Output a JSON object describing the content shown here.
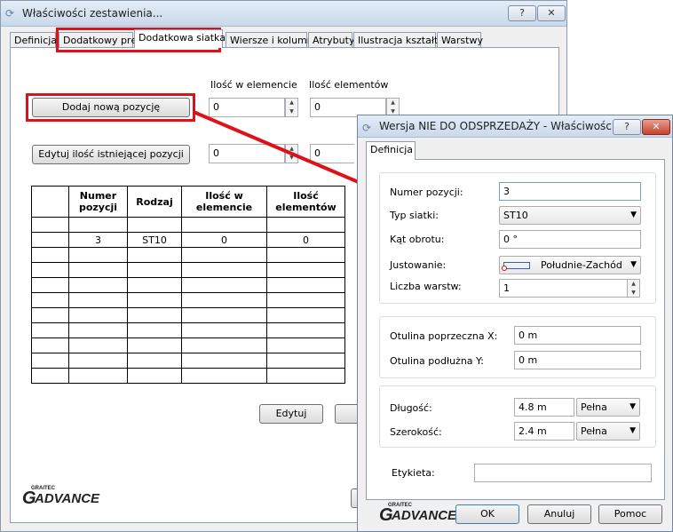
{
  "main_window": {
    "title": "Właściwości zestawienia...",
    "help_btn": "?",
    "close_btn": "✕",
    "tabs": [
      "Definicja",
      "Dodatkowy pręt",
      "Dodatkowa siatka",
      "Wiersze i kolumny",
      "Atrybuty",
      "Ilustracja kształtu",
      "Warstwy"
    ],
    "active_tab": "Dodatkowa siatka",
    "label_qty_element": "Ilość w elemencie",
    "label_qty_elements": "Ilość elementów",
    "add_btn": "Dodaj nową pozycję",
    "edit_qty_btn": "Edytuj ilość istniejącej pozycji",
    "field1": "0",
    "field2": "0",
    "field3": "0",
    "field4": "0",
    "table": {
      "headers": [
        "Numer pozycji",
        "Rodzaj",
        "Ilość w elemencie",
        "Ilość elementów"
      ],
      "rows": [
        [
          "3",
          "ST10",
          "0",
          "0"
        ]
      ]
    },
    "edit_btn": "Edytuj"
  },
  "logo": {
    "small": "GRAITEC",
    "big": "ADVANCE",
    "letter": "G"
  },
  "dialog": {
    "title": "Wersja NIE DO ODSPRZEDAŻY - Właściwości si...",
    "help_btn": "?",
    "close_btn": "✕",
    "tab": "Definicja",
    "numer_label": "Numer pozycji:",
    "numer_value": "3",
    "typ_label": "Typ siatki:",
    "typ_value": "ST10",
    "kat_label": "Kąt obrotu:",
    "kat_value": "0 °",
    "just_label": "Justowanie:",
    "just_value": "Południe-Zachód",
    "warstw_label": "Liczba warstw:",
    "warstw_value": "1",
    "otx_label": "Otulina poprzeczna X:",
    "otx_value": "0 m",
    "oty_label": "Otulina podłużna Y:",
    "oty_value": "0 m",
    "dl_label": "Długość:",
    "dl_value": "4.8 m",
    "dl_mode": "Pełna",
    "sz_label": "Szerokość:",
    "sz_value": "2.4 m",
    "sz_mode": "Pełna",
    "etykieta_label": "Etykieta:",
    "etykieta_value": "",
    "ok": "OK",
    "cancel": "Anuluj",
    "help": "Pomoc"
  },
  "colors": {
    "highlight": "#e0101a"
  }
}
